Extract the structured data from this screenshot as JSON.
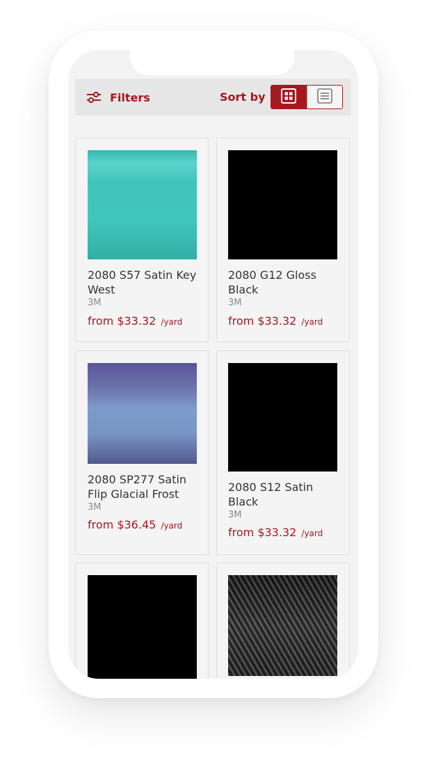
{
  "toolbar": {
    "filters_label": "Filters",
    "sort_label": "Sort by"
  },
  "icons": {
    "filters": "sliders-icon",
    "grid": "grid-view-icon",
    "list": "list-view-icon"
  },
  "colors": {
    "accent": "#a7181f",
    "background": "#f3f3f3",
    "toolbar": "#e6e6e6"
  },
  "products": [
    {
      "title": "2080 S57 Satin Key West",
      "brand": "3M",
      "price": "from $33.32",
      "unit": "/yard",
      "swatch": "teal-satin"
    },
    {
      "title": "2080 G12 Gloss Black",
      "brand": "3M",
      "price": "from $33.32",
      "unit": "/yard",
      "swatch": "black"
    },
    {
      "title": "2080 SP277 Satin Flip Glacial Frost",
      "brand": "3M",
      "price": "from $36.45",
      "unit": "/yard",
      "swatch": "blue-purple-flip"
    },
    {
      "title": "2080 S12 Satin Black",
      "brand": "3M",
      "price": "from $33.32",
      "unit": "/yard",
      "swatch": "black"
    },
    {
      "swatch": "black"
    },
    {
      "swatch": "carbon-fiber"
    }
  ]
}
